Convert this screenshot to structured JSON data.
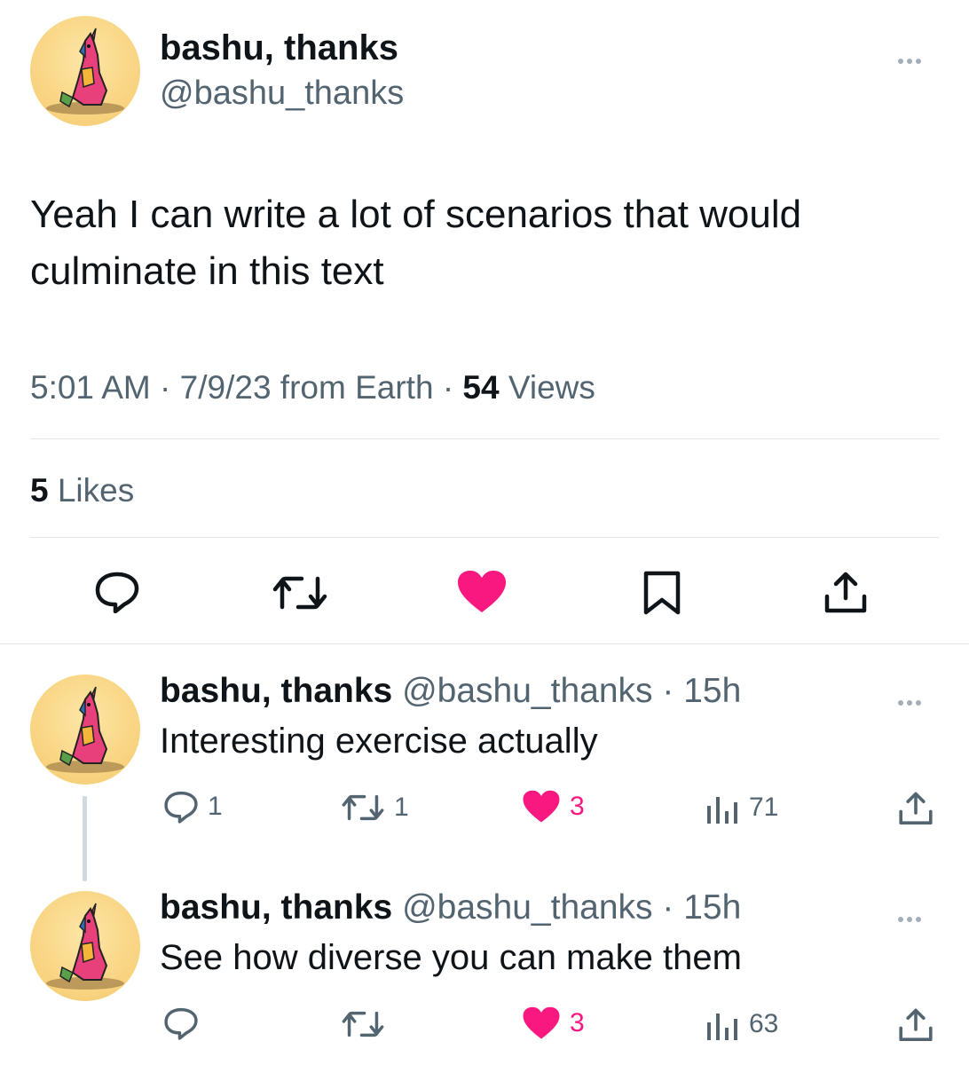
{
  "main_tweet": {
    "author_name": "bashu, thanks",
    "author_handle": "@bashu_thanks",
    "text_line1": "Yeah I can write a lot of scenarios that would",
    "text_line2": "culminate in this text",
    "time": "5:01 AM",
    "date": "7/9/23 from Earth",
    "views_count": "54",
    "views_label": "Views",
    "likes_count": "5",
    "likes_label": "Likes",
    "liked": true
  },
  "replies": [
    {
      "author_name": "bashu, thanks",
      "author_handle": "@bashu_thanks",
      "age": "15h",
      "text": "Interesting exercise actually",
      "reply_count": "1",
      "retweet_count": "1",
      "like_count": "3",
      "view_count": "71"
    },
    {
      "author_name": "bashu, thanks",
      "author_handle": "@bashu_thanks",
      "age": "15h",
      "text": "See how diverse you can make them",
      "reply_count": "",
      "retweet_count": "",
      "like_count": "3",
      "view_count": "63"
    }
  ],
  "separator": "·",
  "icons": {
    "reply": "reply-icon",
    "retweet": "retweet-icon",
    "like": "heart-icon",
    "bookmark": "bookmark-icon",
    "share": "share-icon",
    "views": "views-icon",
    "more": "more-icon"
  },
  "colors": {
    "like_pink": "#f91880",
    "text_primary": "#0f1419",
    "text_secondary": "#536471",
    "divider": "#e1e6ea"
  }
}
